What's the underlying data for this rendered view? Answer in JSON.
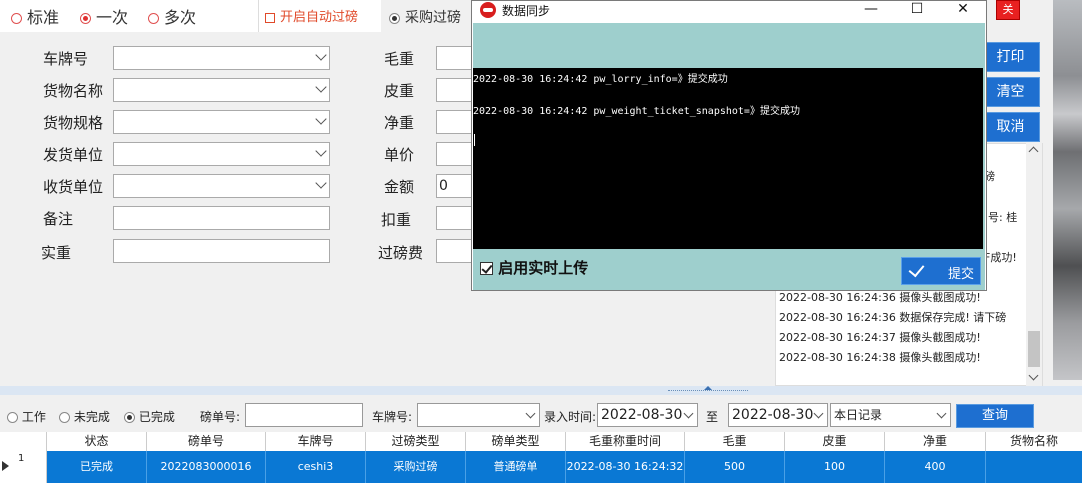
{
  "mode": {
    "options": [
      "标准",
      "一次",
      "多次"
    ],
    "selected": "一次",
    "auto_weigh_label": "开启自动过磅",
    "weigh_type_label": "采购过磅"
  },
  "form": {
    "left_labels": [
      "车牌号",
      "货物名称",
      "货物规格",
      "发货单位",
      "收货单位",
      "备注",
      "实重"
    ],
    "right_labels": [
      "毛重",
      "皮重",
      "净重",
      "单价",
      "金额",
      "扣重",
      "过磅费"
    ],
    "amount_value": "0"
  },
  "side_buttons": {
    "print": "打印",
    "clear": "清空",
    "cancel": "取消",
    "close_glyph": "关"
  },
  "log": {
    "partial": [
      "磅",
      "号: 桂",
      "F成功!"
    ],
    "lines": [
      "2022-08-30 16:24:36 摄像头截图成功!",
      "2022-08-30 16:24:36 数据保存完成! 请下磅",
      "2022-08-30 16:24:37 摄像头截图成功!",
      "2022-08-30 16:24:38 摄像头截图成功!"
    ]
  },
  "dialog": {
    "title": "数据同步",
    "minimize": "—",
    "maximize": "☐",
    "close": "✕",
    "console_lines": [
      "2022-08-30 16:24:42 pw_lorry_info=》提交成功",
      "2022-08-30 16:24:42 pw_weight_ticket_snapshot=》提交成功"
    ],
    "realtime_label": "启用实时上传",
    "realtime_checked": true,
    "submit_label": "提交"
  },
  "filter": {
    "status_options": [
      "工作",
      "未完成",
      "已完成"
    ],
    "status_selected": "已完成",
    "ticket_label": "磅单号:",
    "plate_label": "车牌号:",
    "entry_time_label": "录入时间:",
    "date_from": "2022-08-30",
    "to_label": "至",
    "date_to": "2022-08-30",
    "range_value": "本日记录",
    "query_button": "查询"
  },
  "table": {
    "headers": [
      "状态",
      "磅单号",
      "车牌号",
      "过磅类型",
      "磅单类型",
      "毛重称重时间",
      "毛重",
      "皮重",
      "净重",
      "货物名称"
    ],
    "rows": [
      {
        "index": "1",
        "cells": [
          "已完成",
          "2022083000016",
          "ceshi3",
          "采购过磅",
          "普通磅单",
          "2022-08-30 16:24:32",
          "500",
          "100",
          "400",
          ""
        ]
      }
    ]
  },
  "colors": {
    "accent_blue": "#1e6fd0",
    "selected_row": "#0a78d4",
    "dialog_bg": "#9ecfcd",
    "console_bg": "#000000",
    "warning_red": "#e04a2a"
  }
}
